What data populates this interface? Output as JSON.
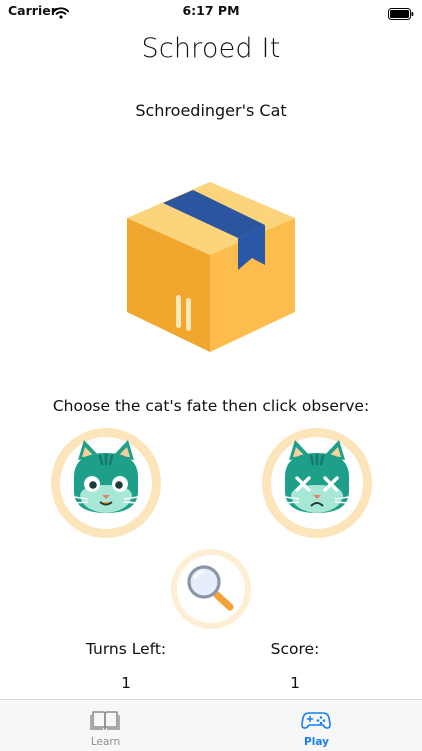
{
  "status_bar": {
    "carrier": "Carrier",
    "time": "6:17 PM",
    "icons": [
      "wifi-icon",
      "battery-icon"
    ]
  },
  "title": "Schroed It",
  "subtitle": "Schroedinger's Cat",
  "box_icon": "cardboard-box-icon",
  "instruction": "Choose the cat's fate then click observe:",
  "choices": [
    {
      "name": "alive-cat",
      "icon": "alive-cat-icon"
    },
    {
      "name": "dead-cat",
      "icon": "dead-cat-icon"
    }
  ],
  "observe": {
    "icon": "magnifying-glass-icon"
  },
  "stats": {
    "turns_label": "Turns Left:",
    "turns_value": "1",
    "score_label": "Score:",
    "score_value": "1"
  },
  "tabbar": {
    "tabs": [
      {
        "label": "Learn",
        "icon": "book-icon",
        "selected": false
      },
      {
        "label": "Play",
        "icon": "gamepad-icon",
        "selected": true
      }
    ]
  },
  "colors": {
    "accent": "#1a7ef2",
    "ring": "#fde4b8",
    "cat_teal": "#1e9f8a",
    "cat_mint": "#a7e7d6",
    "box_yellow": "#fdbf4f",
    "box_tape": "#2855a6"
  }
}
